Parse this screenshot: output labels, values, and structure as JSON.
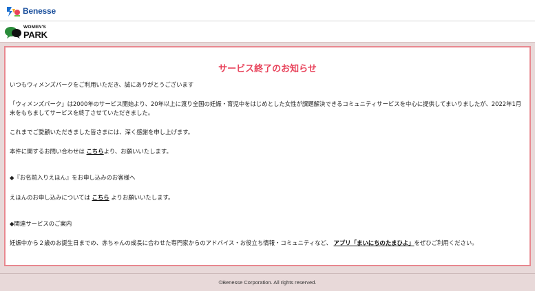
{
  "header": {
    "benesse_logo_text": "Benesse",
    "park_logo_small": "WOMEN'S",
    "park_logo_big": "PARK"
  },
  "notice": {
    "title": "サービス終了のお知らせ",
    "greeting": "いつもウィメンズパークをご利用いただき、誠にありがとうございます",
    "para1_line1": "「ウィメンズパーク」は2000年のサービス開始より、20年以上に渡り全国の妊娠・育児中をはじめとした女性が課題解決できるコミュニティサービスを中心に提供してまいりましたが、2022年1月",
    "para1_line2": "末をもちましてサービスを終了させていただきました。",
    "thanks": "これまでご愛顧いただきました皆さまには、深く感謝を申し上げます。",
    "inquiry_before": "本件に関するお問い合わせは",
    "inquiry_link": "こちら",
    "inquiry_after": "より、お願いいたします。",
    "ehon_heading": "◆『お名前入りえほん』をお申し込みのお客様へ",
    "ehon_before": "えほんのお申し込みについては",
    "ehon_link": "こちら",
    "ehon_after": "よりお願いいたします。",
    "related_heading": "◆関連サービスのご案内",
    "related_before": "妊娠中から２歳のお誕生日までの、赤ちゃんの成長に合わせた専門家からのアドバイス・お役立ち情報・コミュニティなど、",
    "related_link": "アプリ「まいにちのたまひよ」",
    "related_after": "をぜひご利用ください。"
  },
  "footer": {
    "copyright": "©Benesse Corporation. All rights reserved."
  },
  "colors": {
    "title_red": "#e8425a",
    "border_pink": "#e8878f",
    "panel_bg": "#e8d9d9",
    "benesse_blue": "#1a4f9c"
  }
}
